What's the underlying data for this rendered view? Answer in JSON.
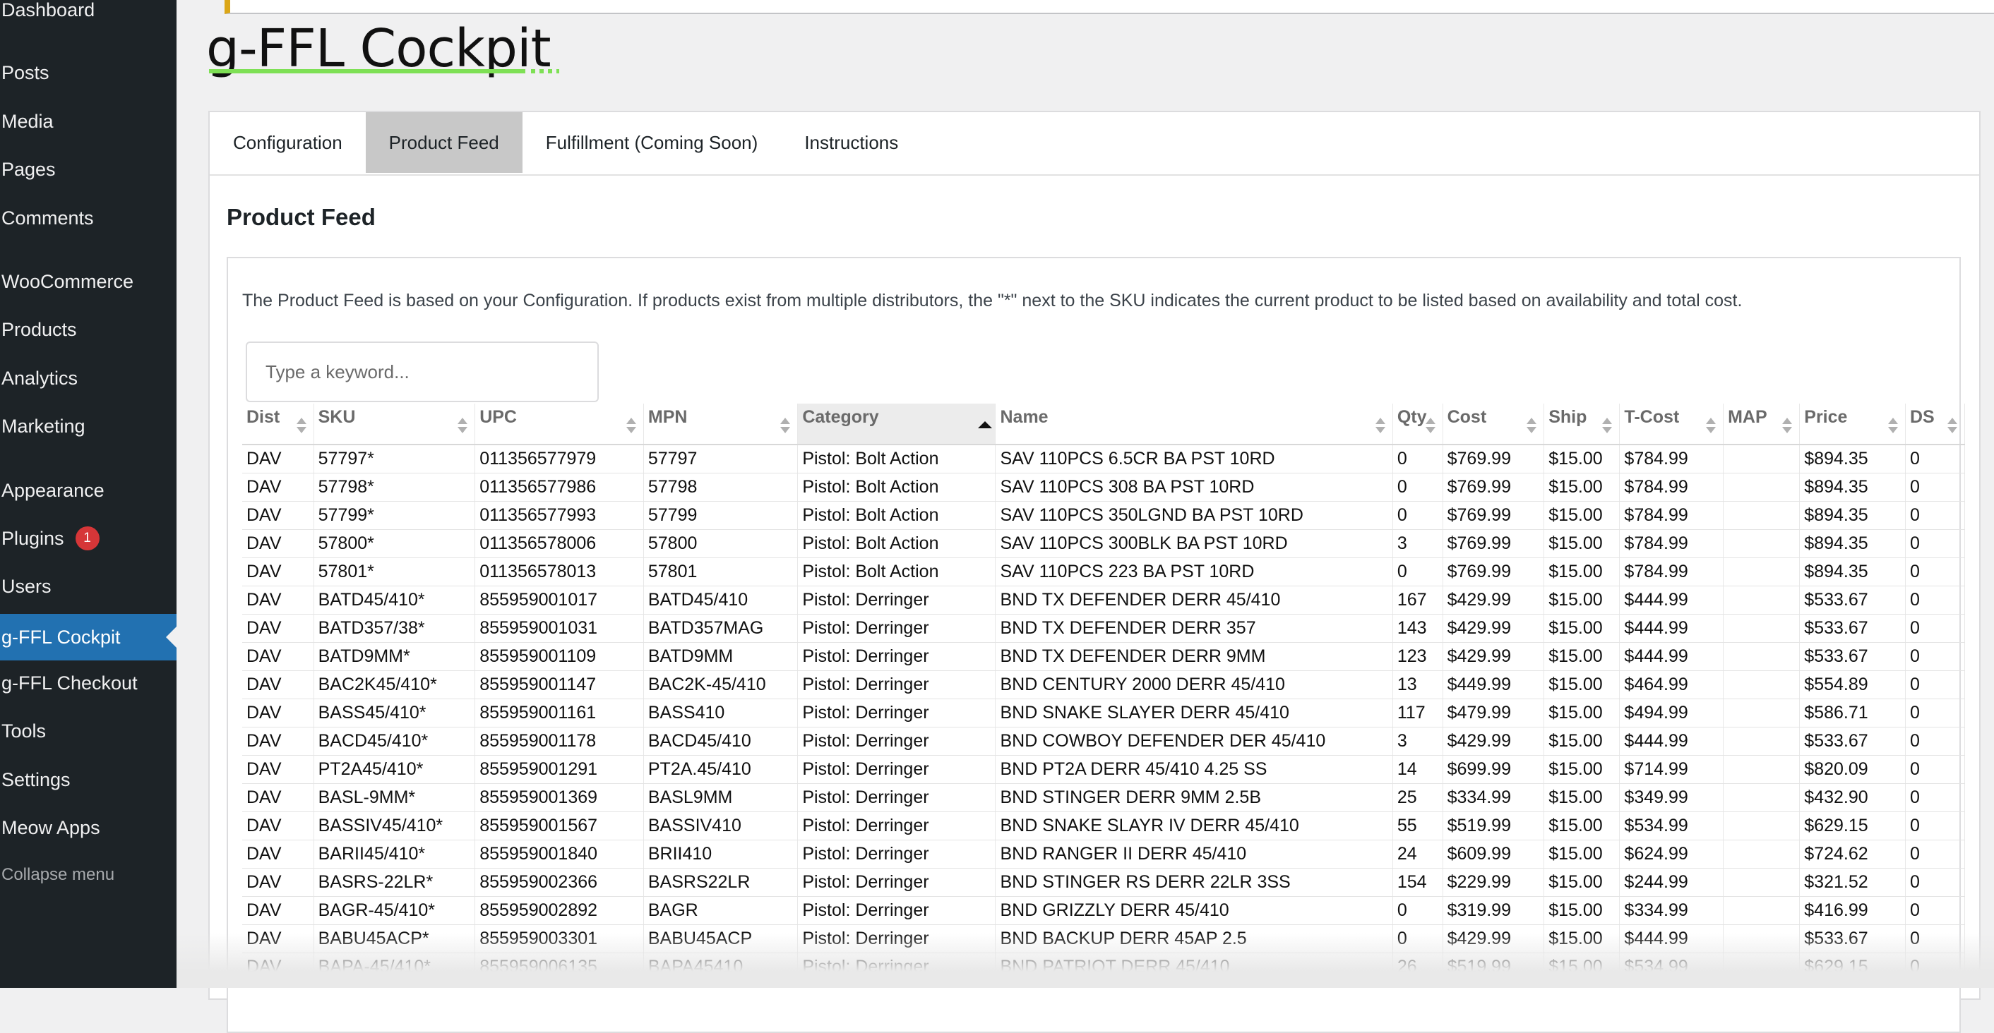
{
  "sidebar": {
    "items": [
      {
        "label": "Dashboard"
      },
      {
        "label": "Posts"
      },
      {
        "label": "Media"
      },
      {
        "label": "Pages"
      },
      {
        "label": "Comments"
      },
      {
        "label": "WooCommerce"
      },
      {
        "label": "Products"
      },
      {
        "label": "Analytics"
      },
      {
        "label": "Marketing"
      },
      {
        "label": "Appearance"
      },
      {
        "label": "Plugins",
        "badge": "1"
      },
      {
        "label": "Users"
      },
      {
        "label": "g-FFL Cockpit",
        "current": true
      },
      {
        "label": "g-FFL Checkout"
      },
      {
        "label": "Tools"
      },
      {
        "label": "Settings"
      },
      {
        "label": "Meow Apps"
      },
      {
        "label": "Collapse menu"
      }
    ],
    "colors": {
      "background": "#1d2327",
      "current": "#2271b1",
      "badge": "#d63638"
    }
  },
  "logo": {
    "text": "g-FFL Cockpit",
    "accent": "#7ee055"
  },
  "tabs": [
    {
      "label": "Configuration"
    },
    {
      "label": "Product Feed",
      "active": true
    },
    {
      "label": "Fulfillment (Coming Soon)"
    },
    {
      "label": "Instructions"
    }
  ],
  "section": {
    "title": "Product Feed",
    "description": "The Product Feed is based on your Configuration. If products exist from multiple distributors, the \"*\" next to the SKU indicates the current product to be listed based on availability and total cost."
  },
  "search": {
    "placeholder": "Type a keyword..."
  },
  "table": {
    "sorted_column": "Category",
    "sort_direction": "ascending",
    "columns": [
      "Dist",
      "SKU",
      "UPC",
      "MPN",
      "Category",
      "Name",
      "Qty",
      "Cost",
      "Ship",
      "T-Cost",
      "MAP",
      "Price",
      "DS"
    ],
    "rows": [
      [
        "DAV",
        "57797*",
        "011356577979",
        "57797",
        "Pistol: Bolt Action",
        "SAV 110PCS 6.5CR BA PST 10RD",
        "0",
        "$769.99",
        "$15.00",
        "$784.99",
        "",
        "$894.35",
        "0"
      ],
      [
        "DAV",
        "57798*",
        "011356577986",
        "57798",
        "Pistol: Bolt Action",
        "SAV 110PCS 308 BA PST 10RD",
        "0",
        "$769.99",
        "$15.00",
        "$784.99",
        "",
        "$894.35",
        "0"
      ],
      [
        "DAV",
        "57799*",
        "011356577993",
        "57799",
        "Pistol: Bolt Action",
        "SAV 110PCS 350LGND BA PST 10RD",
        "0",
        "$769.99",
        "$15.00",
        "$784.99",
        "",
        "$894.35",
        "0"
      ],
      [
        "DAV",
        "57800*",
        "011356578006",
        "57800",
        "Pistol: Bolt Action",
        "SAV 110PCS 300BLK BA PST 10RD",
        "3",
        "$769.99",
        "$15.00",
        "$784.99",
        "",
        "$894.35",
        "0"
      ],
      [
        "DAV",
        "57801*",
        "011356578013",
        "57801",
        "Pistol: Bolt Action",
        "SAV 110PCS 223 BA PST 10RD",
        "0",
        "$769.99",
        "$15.00",
        "$784.99",
        "",
        "$894.35",
        "0"
      ],
      [
        "DAV",
        "BATD45/410*",
        "855959001017",
        "BATD45/410",
        "Pistol: Derringer",
        "BND TX DEFENDER DERR 45/410",
        "167",
        "$429.99",
        "$15.00",
        "$444.99",
        "",
        "$533.67",
        "0"
      ],
      [
        "DAV",
        "BATD357/38*",
        "855959001031",
        "BATD357MAG",
        "Pistol: Derringer",
        "BND TX DEFENDER DERR 357",
        "143",
        "$429.99",
        "$15.00",
        "$444.99",
        "",
        "$533.67",
        "0"
      ],
      [
        "DAV",
        "BATD9MM*",
        "855959001109",
        "BATD9MM",
        "Pistol: Derringer",
        "BND TX DEFENDER DERR 9MM",
        "123",
        "$429.99",
        "$15.00",
        "$444.99",
        "",
        "$533.67",
        "0"
      ],
      [
        "DAV",
        "BAC2K45/410*",
        "855959001147",
        "BAC2K-45/410",
        "Pistol: Derringer",
        "BND CENTURY 2000 DERR 45/410",
        "13",
        "$449.99",
        "$15.00",
        "$464.99",
        "",
        "$554.89",
        "0"
      ],
      [
        "DAV",
        "BASS45/410*",
        "855959001161",
        "BASS410",
        "Pistol: Derringer",
        "BND SNAKE SLAYER DERR 45/410",
        "117",
        "$479.99",
        "$15.00",
        "$494.99",
        "",
        "$586.71",
        "0"
      ],
      [
        "DAV",
        "BACD45/410*",
        "855959001178",
        "BACD45/410",
        "Pistol: Derringer",
        "BND COWBOY DEFENDER DER 45/410",
        "3",
        "$429.99",
        "$15.00",
        "$444.99",
        "",
        "$533.67",
        "0"
      ],
      [
        "DAV",
        "PT2A45/410*",
        "855959001291",
        "PT2A.45/410",
        "Pistol: Derringer",
        "BND PT2A DERR 45/410 4.25 SS",
        "14",
        "$699.99",
        "$15.00",
        "$714.99",
        "",
        "$820.09",
        "0"
      ],
      [
        "DAV",
        "BASL-9MM*",
        "855959001369",
        "BASL9MM",
        "Pistol: Derringer",
        "BND STINGER DERR 9MM 2.5B",
        "25",
        "$334.99",
        "$15.00",
        "$349.99",
        "",
        "$432.90",
        "0"
      ],
      [
        "DAV",
        "BASSIV45/410*",
        "855959001567",
        "BASSIV410",
        "Pistol: Derringer",
        "BND SNAKE SLAYR IV DERR 45/410",
        "55",
        "$519.99",
        "$15.00",
        "$534.99",
        "",
        "$629.15",
        "0"
      ],
      [
        "DAV",
        "BARII45/410*",
        "855959001840",
        "BRII410",
        "Pistol: Derringer",
        "BND RANGER II DERR 45/410",
        "24",
        "$609.99",
        "$15.00",
        "$624.99",
        "",
        "$724.62",
        "0"
      ],
      [
        "DAV",
        "BASRS-22LR*",
        "855959002366",
        "BASRS22LR",
        "Pistol: Derringer",
        "BND STINGER RS DERR 22LR 3SS",
        "154",
        "$229.99",
        "$15.00",
        "$244.99",
        "",
        "$321.52",
        "0"
      ],
      [
        "DAV",
        "BAGR-45/410*",
        "855959002892",
        "BAGR",
        "Pistol: Derringer",
        "BND GRIZZLY DERR 45/410",
        "0",
        "$319.99",
        "$15.00",
        "$334.99",
        "",
        "$416.99",
        "0"
      ],
      [
        "DAV",
        "BABU45ACP*",
        "855959003301",
        "BABU45ACP",
        "Pistol: Derringer",
        "BND BACKUP DERR 45AP 2.5",
        "0",
        "$429.99",
        "$15.00",
        "$444.99",
        "",
        "$533.67",
        "0"
      ],
      [
        "DAV",
        "BAPA-45/410*",
        "855959006135",
        "BAPA45410",
        "Pistol: Derringer",
        "BND PATRIOT DERR 45/410",
        "26",
        "$519.99",
        "$15.00",
        "$534.99",
        "",
        "$629.15",
        "0"
      ]
    ]
  }
}
